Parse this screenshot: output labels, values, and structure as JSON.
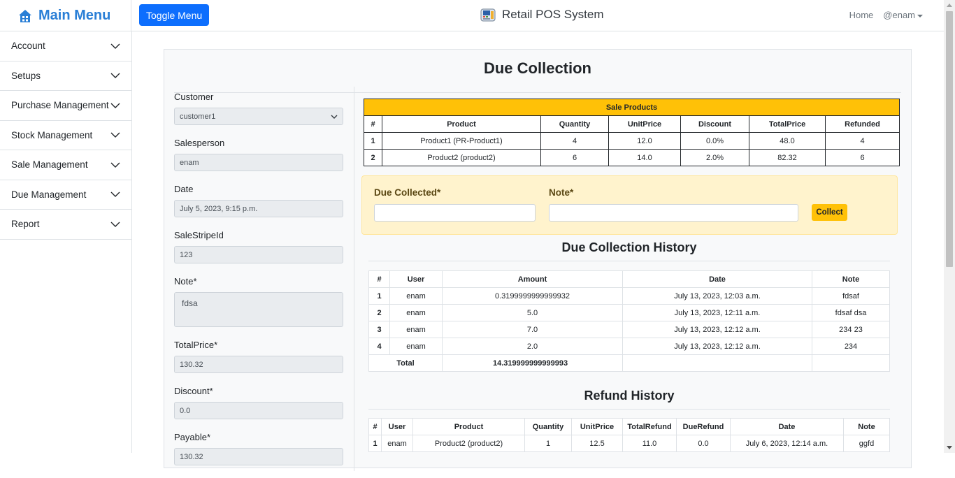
{
  "header": {
    "brand": "Main Menu",
    "toggle_label": "Toggle Menu",
    "app_title": "Retail POS System",
    "nav_home": "Home",
    "nav_user": "@enam"
  },
  "sidebar": {
    "items": [
      {
        "label": "Account"
      },
      {
        "label": "Setups"
      },
      {
        "label": "Purchase Management"
      },
      {
        "label": "Stock Management"
      },
      {
        "label": "Sale Management"
      },
      {
        "label": "Due Management"
      },
      {
        "label": "Report"
      }
    ]
  },
  "page": {
    "title": "Due Collection"
  },
  "form": {
    "customer_label": "Customer",
    "customer_value": "customer1",
    "salesperson_label": "Salesperson",
    "salesperson_value": "enam",
    "date_label": "Date",
    "date_value": "July 5, 2023, 9:15 p.m.",
    "stripe_label": "SaleStripeId",
    "stripe_value": "123",
    "note_label": "Note*",
    "note_value": "fdsa",
    "total_label": "TotalPrice*",
    "total_value": "130.32",
    "discount_label": "Discount*",
    "discount_value": "0.0",
    "payable_label": "Payable*",
    "payable_value": "130.32"
  },
  "sale_products": {
    "caption": "Sale Products",
    "headers": [
      "#",
      "Product",
      "Quantity",
      "UnitPrice",
      "Discount",
      "TotalPrice",
      "Refunded"
    ],
    "rows": [
      [
        "1",
        "Product1 (PR-Product1)",
        "4",
        "12.0",
        "0.0%",
        "48.0",
        "4"
      ],
      [
        "2",
        "Product2 (product2)",
        "6",
        "14.0",
        "2.0%",
        "82.32",
        "6"
      ]
    ]
  },
  "collect": {
    "due_label": "Due Collected*",
    "note_label": "Note*",
    "button": "Collect"
  },
  "due_history": {
    "title": "Due Collection History",
    "headers": [
      "#",
      "User",
      "Amount",
      "Date",
      "Note"
    ],
    "rows": [
      [
        "1",
        "enam",
        "0.3199999999999932",
        "July 13, 2023, 12:03 a.m.",
        "fdsaf"
      ],
      [
        "2",
        "enam",
        "5.0",
        "July 13, 2023, 12:11 a.m.",
        "fdsaf dsa"
      ],
      [
        "3",
        "enam",
        "7.0",
        "July 13, 2023, 12:12 a.m.",
        "234 23"
      ],
      [
        "4",
        "enam",
        "2.0",
        "July 13, 2023, 12:12 a.m.",
        "234"
      ]
    ],
    "total_label": "Total",
    "total_value": "14.319999999999993"
  },
  "refund_history": {
    "title": "Refund History",
    "headers": [
      "#",
      "User",
      "Product",
      "Quantity",
      "UnitPrice",
      "TotalRefund",
      "DueRefund",
      "Date",
      "Note"
    ],
    "rows": [
      [
        "1",
        "enam",
        "Product2 (product2)",
        "1",
        "12.5",
        "11.0",
        "0.0",
        "July 6, 2023, 12:14 a.m.",
        "ggfd"
      ]
    ]
  },
  "colors": {
    "primary": "#0d6efd",
    "brand": "#2a7fd6",
    "warning": "#ffc107",
    "warning_bg": "#fff3cd"
  }
}
